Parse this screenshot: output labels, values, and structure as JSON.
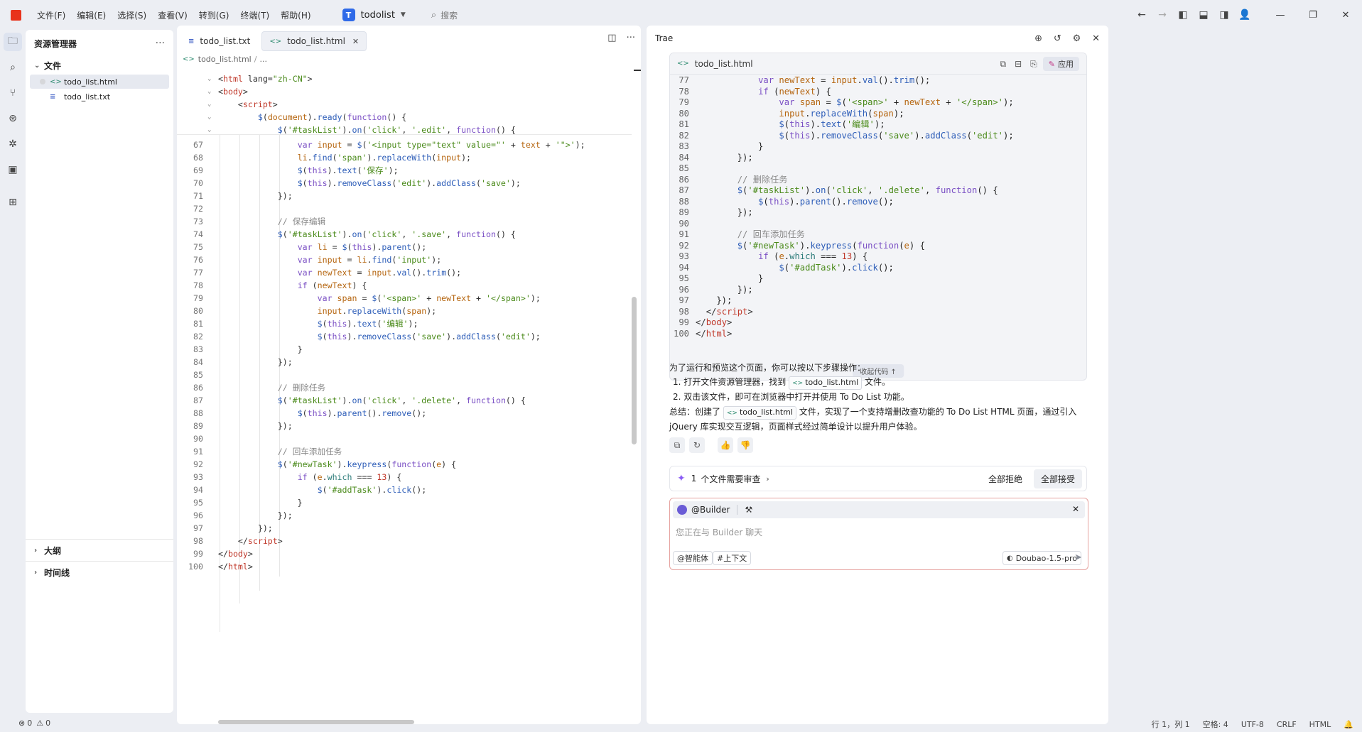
{
  "menu": [
    "文件(F)",
    "编辑(E)",
    "选择(S)",
    "查看(V)",
    "转到(G)",
    "终端(T)",
    "帮助(H)"
  ],
  "workspace": {
    "badge": "T",
    "name": "todolist"
  },
  "search": {
    "placeholder": "搜索"
  },
  "explorer": {
    "title": "资源管理器",
    "section": "文件",
    "files": [
      {
        "name": "todo_list.html",
        "type": "html",
        "selected": true
      },
      {
        "name": "todo_list.txt",
        "type": "txt",
        "selected": false
      }
    ],
    "outline": "大纲",
    "timeline": "时间线"
  },
  "editor": {
    "tabs": [
      {
        "label": "todo_list.txt",
        "type": "txt",
        "active": false
      },
      {
        "label": "todo_list.html",
        "type": "html",
        "active": true
      }
    ],
    "breadcrumb": [
      "todo_list.html",
      "..."
    ],
    "sticky": [
      {
        "fold": "⌄",
        "html": "<span class='pl'>&lt;</span><span class='tg'>html</span> <span class='at'>lang=</span><span class='st'>\"zh-CN\"</span><span class='pl'>&gt;</span>"
      },
      {
        "fold": "⌄",
        "html": "<span class='pl'>&lt;</span><span class='tg'>body</span><span class='pl'>&gt;</span>"
      },
      {
        "fold": "⌄",
        "html": "    <span class='pl'>&lt;</span><span class='tg'>script</span><span class='pl'>&gt;</span>"
      },
      {
        "fold": "⌄",
        "html": "        <span class='fn'>$</span>(<span class='vr'>document</span>).<span class='fn'>ready</span>(<span class='kw'>function</span>() {"
      },
      {
        "fold": "⌄",
        "html": "            <span class='fn'>$</span>(<span class='st'>'#taskList'</span>).<span class='fn'>on</span>(<span class='st'>'click'</span>, <span class='st'>'.edit'</span>, <span class='kw'>function</span>() {"
      }
    ],
    "lines": [
      {
        "n": "67",
        "html": "                <span class='kw'>var</span> <span class='vr'>input</span> = <span class='fn'>$</span>(<span class='st'>'&lt;input type=\"text\" value=\"'</span> + <span class='vr'>text</span> + <span class='st'>'\"&gt;'</span>);"
      },
      {
        "n": "68",
        "html": "                <span class='vr'>li</span>.<span class='fn'>find</span>(<span class='st'>'span'</span>).<span class='fn'>replaceWith</span>(<span class='vr'>input</span>);"
      },
      {
        "n": "69",
        "html": "                <span class='fn'>$</span>(<span class='kw'>this</span>).<span class='fn'>text</span>(<span class='st'>'保存'</span>);"
      },
      {
        "n": "70",
        "html": "                <span class='fn'>$</span>(<span class='kw'>this</span>).<span class='fn'>removeClass</span>(<span class='st'>'edit'</span>).<span class='fn'>addClass</span>(<span class='st'>'save'</span>);"
      },
      {
        "n": "71",
        "html": "            });"
      },
      {
        "n": "72",
        "html": ""
      },
      {
        "n": "73",
        "html": "            <span class='cm'>// 保存编辑</span>"
      },
      {
        "n": "74",
        "html": "            <span class='fn'>$</span>(<span class='st'>'#taskList'</span>).<span class='fn'>on</span>(<span class='st'>'click'</span>, <span class='st'>'.save'</span>, <span class='kw'>function</span>() {"
      },
      {
        "n": "75",
        "html": "                <span class='kw'>var</span> <span class='vr'>li</span> = <span class='fn'>$</span>(<span class='kw'>this</span>).<span class='fn'>parent</span>();"
      },
      {
        "n": "76",
        "html": "                <span class='kw'>var</span> <span class='vr'>input</span> = <span class='vr'>li</span>.<span class='fn'>find</span>(<span class='st'>'input'</span>);"
      },
      {
        "n": "77",
        "html": "                <span class='kw'>var</span> <span class='vr'>newText</span> = <span class='vr'>input</span>.<span class='fn'>val</span>().<span class='fn'>trim</span>();"
      },
      {
        "n": "78",
        "html": "                <span class='kw'>if</span> (<span class='vr'>newText</span>) {"
      },
      {
        "n": "79",
        "html": "                    <span class='kw'>var</span> <span class='vr'>span</span> = <span class='fn'>$</span>(<span class='st'>'&lt;span&gt;'</span> + <span class='vr'>newText</span> + <span class='st'>'&lt;/span&gt;'</span>);"
      },
      {
        "n": "80",
        "html": "                    <span class='vr'>input</span>.<span class='fn'>replaceWith</span>(<span class='vr'>span</span>);"
      },
      {
        "n": "81",
        "html": "                    <span class='fn'>$</span>(<span class='kw'>this</span>).<span class='fn'>text</span>(<span class='st'>'编辑'</span>);"
      },
      {
        "n": "82",
        "html": "                    <span class='fn'>$</span>(<span class='kw'>this</span>).<span class='fn'>removeClass</span>(<span class='st'>'save'</span>).<span class='fn'>addClass</span>(<span class='st'>'edit'</span>);"
      },
      {
        "n": "83",
        "html": "                }"
      },
      {
        "n": "84",
        "html": "            });"
      },
      {
        "n": "85",
        "html": ""
      },
      {
        "n": "86",
        "html": "            <span class='cm'>// 删除任务</span>"
      },
      {
        "n": "87",
        "html": "            <span class='fn'>$</span>(<span class='st'>'#taskList'</span>).<span class='fn'>on</span>(<span class='st'>'click'</span>, <span class='st'>'.delete'</span>, <span class='kw'>function</span>() {"
      },
      {
        "n": "88",
        "html": "                <span class='fn'>$</span>(<span class='kw'>this</span>).<span class='fn'>parent</span>().<span class='fn'>remove</span>();"
      },
      {
        "n": "89",
        "html": "            });"
      },
      {
        "n": "90",
        "html": ""
      },
      {
        "n": "91",
        "html": "            <span class='cm'>// 回车添加任务</span>"
      },
      {
        "n": "92",
        "html": "            <span class='fn'>$</span>(<span class='st'>'#newTask'</span>).<span class='fn'>keypress</span>(<span class='kw'>function</span>(<span class='vr'>e</span>) {"
      },
      {
        "n": "93",
        "html": "                <span class='kw'>if</span> (<span class='vr'>e</span>.<span class='mt'>which</span> === <span class='nm'>13</span>) {"
      },
      {
        "n": "94",
        "html": "                    <span class='fn'>$</span>(<span class='st'>'#addTask'</span>).<span class='fn'>click</span>();"
      },
      {
        "n": "95",
        "html": "                }"
      },
      {
        "n": "96",
        "html": "            });"
      },
      {
        "n": "97",
        "html": "        });"
      },
      {
        "n": "98",
        "html": "    <span class='pl'>&lt;/</span><span class='tg'>script</span><span class='pl'>&gt;</span>"
      },
      {
        "n": "99",
        "html": "<span class='pl'>&lt;/</span><span class='tg'>body</span><span class='pl'>&gt;</span>"
      },
      {
        "n": "100",
        "html": "<span class='pl'>&lt;/</span><span class='tg'>html</span><span class='pl'>&gt;</span>"
      }
    ]
  },
  "chat": {
    "title": "Trae",
    "code_block": {
      "file": "todo_list.html",
      "apply_label": "应用",
      "collapse_label": "收起代码 ↑",
      "lines": [
        {
          "n": "77",
          "html": "            <span class='kw'>var</span> <span class='vr'>newText</span> = <span class='vr'>input</span>.<span class='fn'>val</span>().<span class='fn'>trim</span>();"
        },
        {
          "n": "78",
          "html": "            <span class='kw'>if</span> (<span class='vr'>newText</span>) {"
        },
        {
          "n": "79",
          "html": "                <span class='kw'>var</span> <span class='vr'>span</span> = <span class='fn'>$</span>(<span class='st'>'&lt;span&gt;'</span> + <span class='vr'>newText</span> + <span class='st'>'&lt;/span&gt;'</span>);"
        },
        {
          "n": "80",
          "html": "                <span class='vr'>input</span>.<span class='fn'>replaceWith</span>(<span class='vr'>span</span>);"
        },
        {
          "n": "81",
          "html": "                <span class='fn'>$</span>(<span class='kw'>this</span>).<span class='fn'>text</span>(<span class='st'>'编辑'</span>);"
        },
        {
          "n": "82",
          "html": "                <span class='fn'>$</span>(<span class='kw'>this</span>).<span class='fn'>removeClass</span>(<span class='st'>'save'</span>).<span class='fn'>addClass</span>(<span class='st'>'edit'</span>);"
        },
        {
          "n": "83",
          "html": "            }"
        },
        {
          "n": "84",
          "html": "        });"
        },
        {
          "n": "85",
          "html": ""
        },
        {
          "n": "86",
          "html": "        <span class='cm'>// 删除任务</span>"
        },
        {
          "n": "87",
          "html": "        <span class='fn'>$</span>(<span class='st'>'#taskList'</span>).<span class='fn'>on</span>(<span class='st'>'click'</span>, <span class='st'>'.delete'</span>, <span class='kw'>function</span>() {"
        },
        {
          "n": "88",
          "html": "            <span class='fn'>$</span>(<span class='kw'>this</span>).<span class='fn'>parent</span>().<span class='fn'>remove</span>();"
        },
        {
          "n": "89",
          "html": "        });"
        },
        {
          "n": "90",
          "html": ""
        },
        {
          "n": "91",
          "html": "        <span class='cm'>// 回车添加任务</span>"
        },
        {
          "n": "92",
          "html": "        <span class='fn'>$</span>(<span class='st'>'#newTask'</span>).<span class='fn'>keypress</span>(<span class='kw'>function</span>(<span class='vr'>e</span>) {"
        },
        {
          "n": "93",
          "html": "            <span class='kw'>if</span> (<span class='vr'>e</span>.<span class='mt'>which</span> === <span class='nm'>13</span>) {"
        },
        {
          "n": "94",
          "html": "                <span class='fn'>$</span>(<span class='st'>'#addTask'</span>).<span class='fn'>click</span>();"
        },
        {
          "n": "95",
          "html": "            }"
        },
        {
          "n": "96",
          "html": "        });"
        },
        {
          "n": "97",
          "html": "    });"
        },
        {
          "n": "98",
          "html": "  <span class='pl'>&lt;/</span><span class='tg'>script</span><span class='pl'>&gt;</span>"
        },
        {
          "n": "99",
          "html": "<span class='pl'>&lt;/</span><span class='tg'>body</span><span class='pl'>&gt;</span>"
        },
        {
          "n": "100",
          "html": "<span class='pl'>&lt;/</span><span class='tg'>html</span><span class='pl'>&gt;</span>"
        }
      ]
    },
    "intro": "为了运行和预览这个页面，你可以按以下步骤操作：",
    "step1_pre": "1. 打开文件资源管理器，找到",
    "step1_file": "todo_list.html",
    "step1_post": "文件。",
    "step2": "2. 双击该文件，即可在浏览器中打开并使用 To Do List 功能。",
    "summary_pre": "总结：创建了",
    "summary_file": "todo_list.html",
    "summary_post": "文件，实现了一个支持增删改查功能的 To Do List HTML 页面，通过引入 jQuery 库实现交互逻辑，页面样式经过简单设计以提升用户体验。",
    "review": {
      "count": "1",
      "text": "个文件需要审查",
      "reject_all": "全部拒绝",
      "accept_all": "全部接受"
    },
    "input": {
      "agent": "@Builder",
      "placeholder": "您正在与 Builder 聊天",
      "pill_agent": "@智能体",
      "pill_context": "#上下文",
      "model": "Doubao-1.5-pro"
    }
  },
  "statusbar": {
    "errors": "0",
    "warnings": "0",
    "position": "行 1，列 1",
    "spaces": "空格: 4",
    "encoding": "UTF-8",
    "eol": "CRLF",
    "language": "HTML"
  }
}
